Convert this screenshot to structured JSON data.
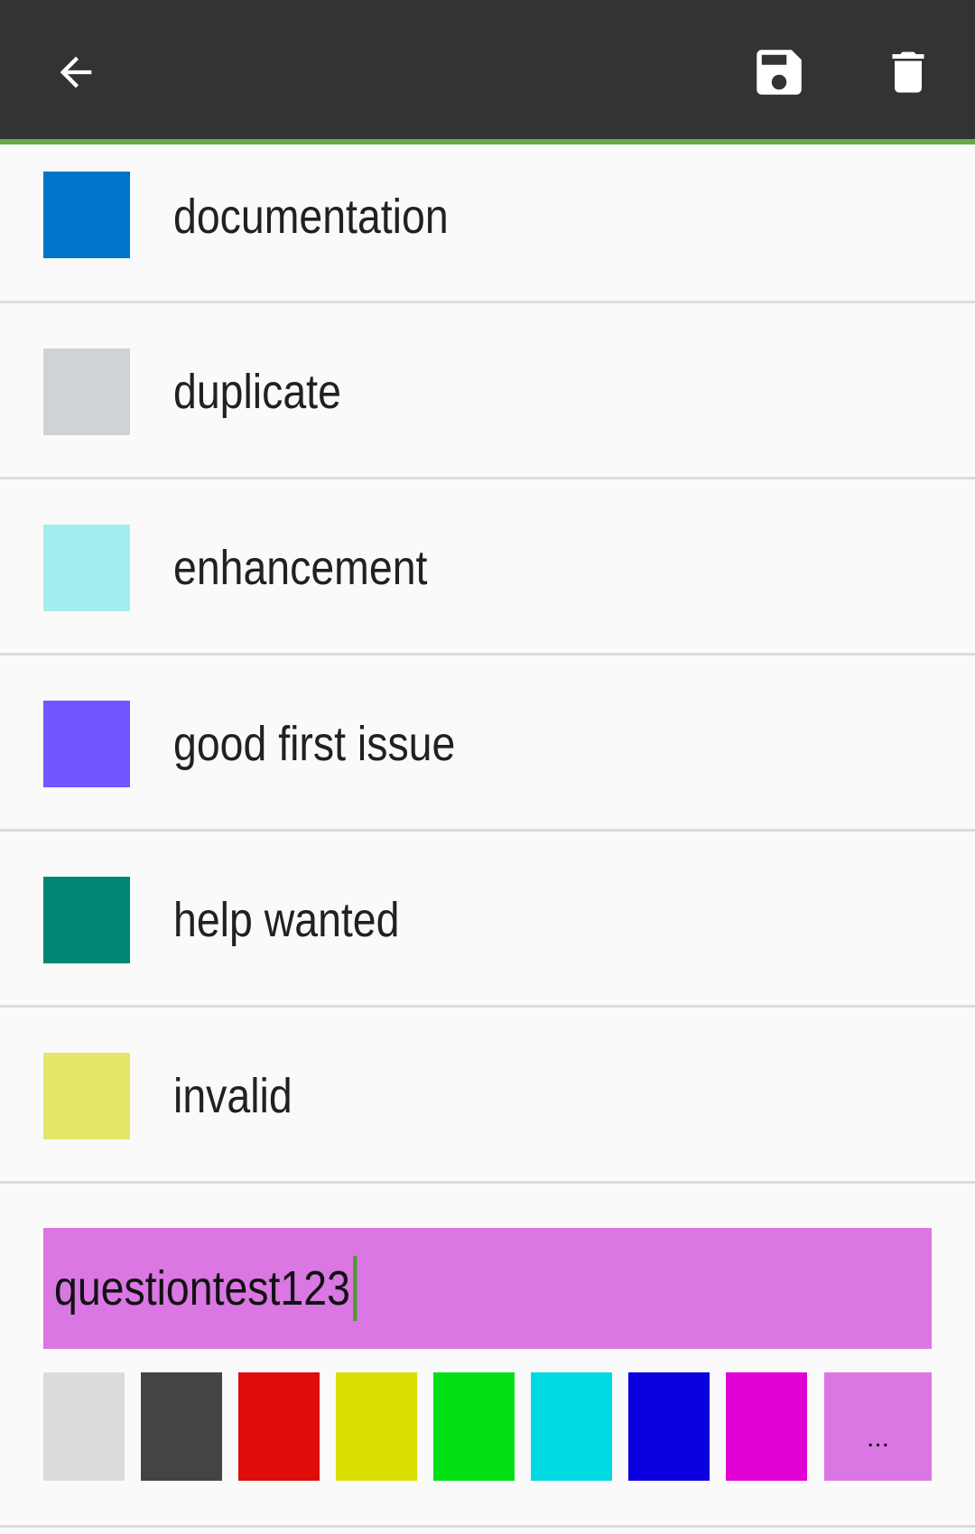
{
  "toolbar": {
    "back_icon": "arrow-left-icon",
    "save_icon": "floppy-disk-icon",
    "delete_icon": "trash-icon",
    "background": "#333333",
    "accent": "#6aa84f"
  },
  "labels": [
    {
      "name": "documentation",
      "color": "#0075ca"
    },
    {
      "name": "duplicate",
      "color": "#cfd3d7"
    },
    {
      "name": "enhancement",
      "color": "#a2eeef"
    },
    {
      "name": "good first issue",
      "color": "#7057ff"
    },
    {
      "name": "help wanted",
      "color": "#008672"
    },
    {
      "name": "invalid",
      "color": "#e4e669"
    }
  ],
  "editor": {
    "value": "questiontest123",
    "selected_color": "#da77e3",
    "palette": [
      "#dcdcdc",
      "#444444",
      "#e00b0b",
      "#d9e000",
      "#00e014",
      "#00d9e0",
      "#0a00e0",
      "#e000d4"
    ],
    "more_label": "..."
  }
}
